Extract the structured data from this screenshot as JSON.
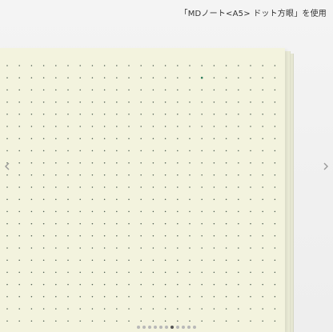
{
  "caption": "「MDノート<A5> ドット方眼」を使用",
  "icons": {
    "prev": "chevron-left-icon",
    "next": "chevron-right-icon"
  },
  "carousel": {
    "total_slides": 11,
    "active_index": 6
  },
  "colors": {
    "paper": "#f3f3de",
    "dot": "#4a5b4f",
    "highlight_dot": "#2e7d5b",
    "active_indicator": "#555555",
    "inactive_indicator": "#b8b8b8"
  }
}
